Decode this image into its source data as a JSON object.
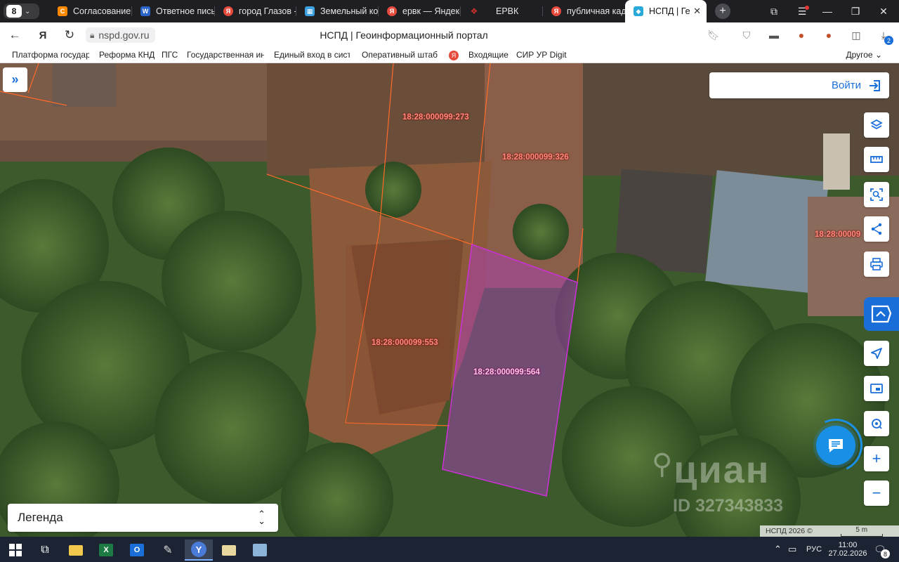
{
  "browser": {
    "tab_count": "8",
    "tabs": [
      {
        "label": "Согласование",
        "color": "#ff8a00",
        "glyph": "С"
      },
      {
        "label": "Ответное письмо",
        "color": "#2b64c8",
        "glyph": "W"
      },
      {
        "label": "город Глазов -",
        "color": "#e64a3c",
        "glyph": "Я"
      },
      {
        "label": "Земельный кодекс",
        "color": "#3aa0e0",
        "glyph": "▦"
      },
      {
        "label": "ервк — Яндекс",
        "color": "#e64a3c",
        "glyph": "Я"
      },
      {
        "label": "ЕРВК",
        "color": "#c8302a",
        "glyph": "❖"
      },
      {
        "label": "публичная кадастровая",
        "color": "#e64a3c",
        "glyph": "Я"
      },
      {
        "label": "НСПД | Геоинформационный портал",
        "color": "#2aa8d8",
        "glyph": "◆"
      }
    ],
    "url": "nspd.gov.ru",
    "page_title": "НСПД | Геоинформационный портал",
    "downloads_badge": "2",
    "bookmarks": [
      "Платформа государственных",
      "Реформа КНД",
      "ПГС",
      "Государственная информационная",
      "Единый вход в системы",
      "Оперативный штаб",
      "Входящие",
      "СИР УР Digit"
    ],
    "bookmarks_other": "Другое"
  },
  "map": {
    "login_label": "Войти",
    "legend_label": "Легенда",
    "parcels": [
      {
        "id": "p273",
        "label": "18:28:000099:273"
      },
      {
        "id": "p326",
        "label": "18:28:000099:326"
      },
      {
        "id": "p_right",
        "label": "18:28:00009"
      },
      {
        "id": "p553",
        "label": "18:28:000099:553"
      },
      {
        "id": "p564",
        "label": "18:28:000099:564",
        "selected": true
      }
    ],
    "watermark": "циан",
    "watermark_id": "ID 327343833",
    "attribution": "НСПД 2026 ©",
    "scale": "5 m",
    "colors": {
      "parcel_border": "#ff6a2a",
      "selected_fill": "#b43cc8",
      "selected_border": "#c832d2",
      "accent": "#1a6ed8"
    }
  },
  "taskbar": {
    "language": "РУС",
    "time": "11:00",
    "date": "27.02.2026",
    "notification_count": "8"
  }
}
